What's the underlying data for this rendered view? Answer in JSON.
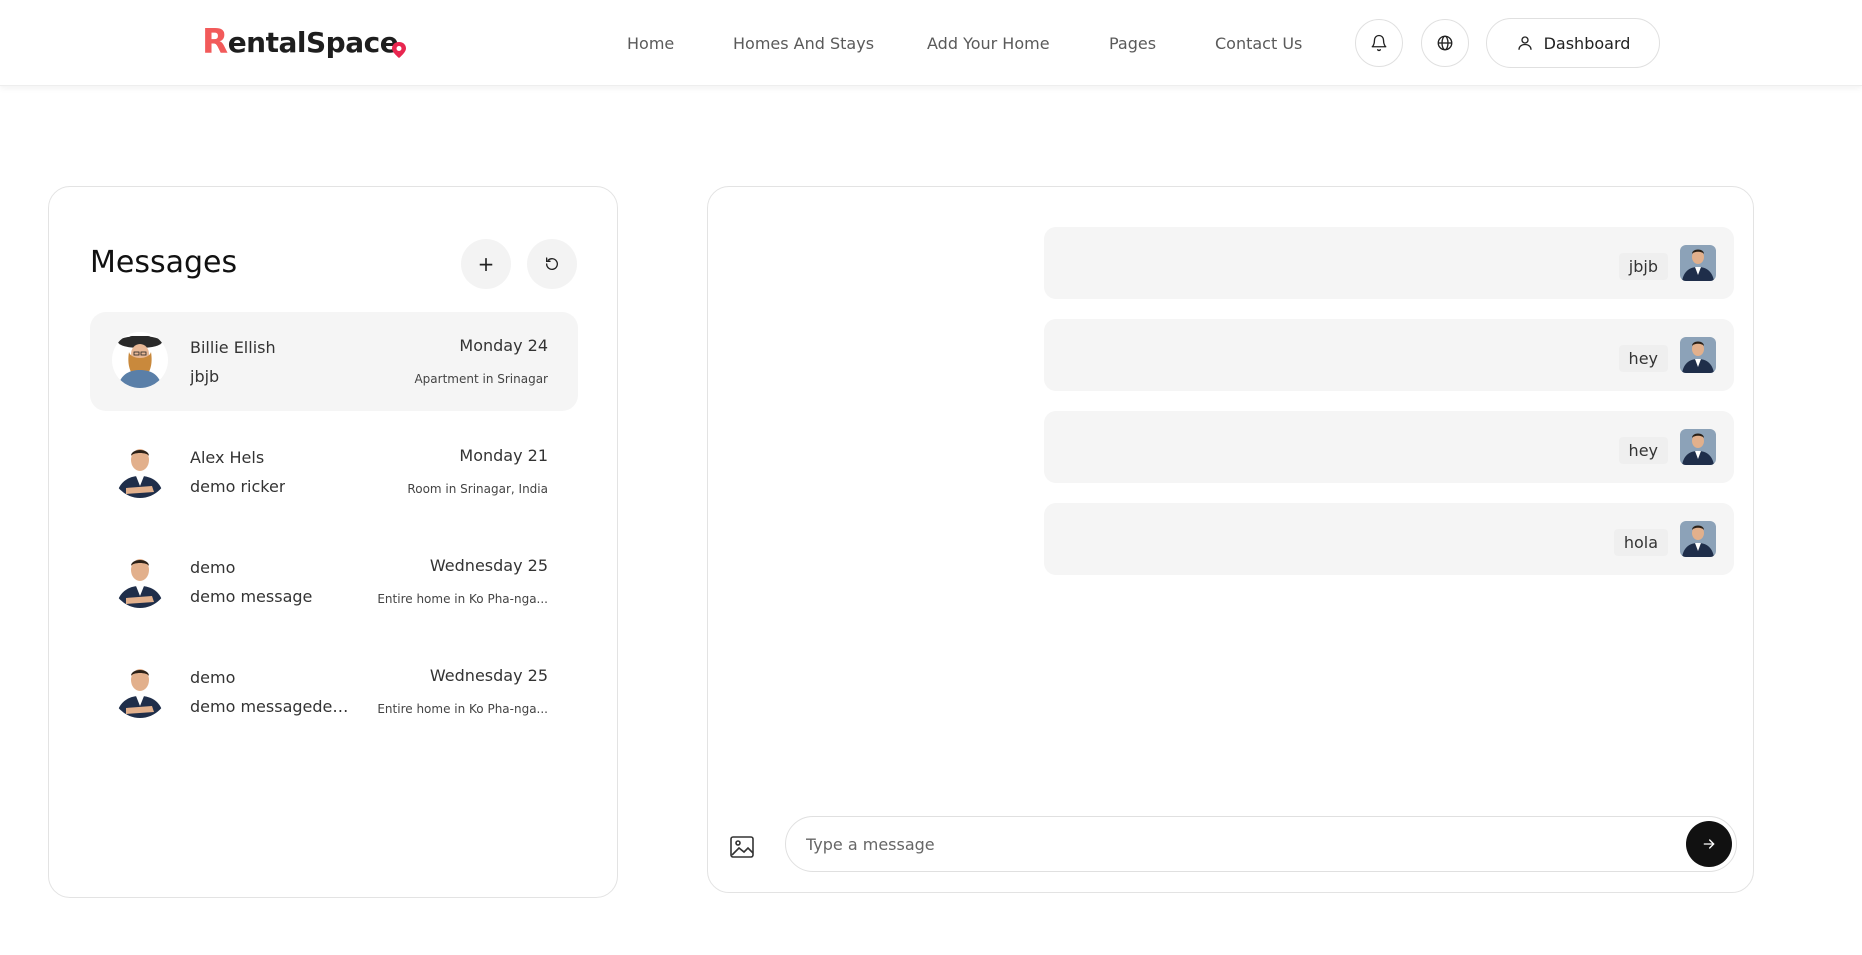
{
  "header": {
    "logo_text_first": "R",
    "logo_text_rest": "entalSpac",
    "logo_text_last": "e",
    "nav": [
      "Home",
      "Homes And Stays",
      "Add Your Home",
      "Pages",
      "Contact Us"
    ],
    "bell_icon": "bell-icon",
    "globe_icon": "globe-icon",
    "dashboard_label": "Dashboard"
  },
  "colors": {
    "brand": "#f25a5a",
    "send_button": "#111111",
    "active_conversation": "#f5f5f5"
  },
  "messages_panel": {
    "title": "Messages",
    "add_icon": "plus-icon",
    "refresh_icon": "refresh-icon",
    "conversations": [
      {
        "name": "Billie Ellish",
        "preview": "jbjb",
        "date": "Monday 24",
        "place": "Apartment in Srinagar",
        "active": true
      },
      {
        "name": "Alex Hels",
        "preview": "demo ricker",
        "date": "Monday 21",
        "place": "Room in Srinagar, India",
        "active": false
      },
      {
        "name": "demo",
        "preview": "demo message",
        "date": "Wednesday 25",
        "place": "Entire home in Ko Pha-nga...",
        "active": false
      },
      {
        "name": "demo",
        "preview": "demo messagedem...",
        "date": "Wednesday 25",
        "place": "Entire home in Ko Pha-nga...",
        "active": false
      }
    ]
  },
  "chat": {
    "messages": [
      "jbjb",
      "hey",
      "hey",
      "hola"
    ],
    "input_placeholder": "Type a message",
    "image_icon": "image-icon",
    "send_icon": "arrow-right-icon"
  }
}
